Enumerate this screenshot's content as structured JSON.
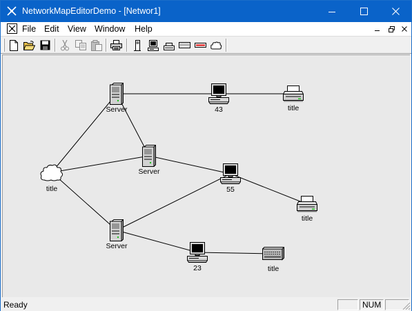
{
  "window": {
    "title": "NetworkMapEditorDemo - [Networ1]",
    "accent_color": "#0a63c9"
  },
  "menu": {
    "items": [
      "File",
      "Edit",
      "View",
      "Window",
      "Help"
    ]
  },
  "toolbar": {
    "buttons": [
      {
        "name": "new-file-icon",
        "enabled": true
      },
      {
        "name": "open-folder-icon",
        "enabled": true
      },
      {
        "name": "save-icon",
        "enabled": true
      },
      {
        "name": "cut-icon",
        "enabled": false
      },
      {
        "name": "copy-icon",
        "enabled": false
      },
      {
        "name": "paste-icon",
        "enabled": false
      },
      {
        "name": "print-icon",
        "enabled": true
      },
      {
        "name": "server-tool-icon",
        "enabled": true
      },
      {
        "name": "computer-tool-icon",
        "enabled": true
      },
      {
        "name": "printer-tool-icon",
        "enabled": true
      },
      {
        "name": "hub-tool-icon",
        "enabled": true
      },
      {
        "name": "link-tool-icon",
        "enabled": true
      },
      {
        "name": "cloud-tool-icon",
        "enabled": true
      }
    ]
  },
  "network": {
    "nodes": [
      {
        "id": "server1",
        "type": "server",
        "label": "Server"
      },
      {
        "id": "pc43",
        "type": "computer",
        "label": "43"
      },
      {
        "id": "printer1",
        "type": "printer",
        "label": "title"
      },
      {
        "id": "server2",
        "type": "server",
        "label": "Server"
      },
      {
        "id": "cloud1",
        "type": "cloud",
        "label": "title"
      },
      {
        "id": "pc55",
        "type": "computer",
        "label": "55"
      },
      {
        "id": "printer2",
        "type": "printer",
        "label": "title"
      },
      {
        "id": "server3",
        "type": "server",
        "label": "Server"
      },
      {
        "id": "pc23",
        "type": "computer",
        "label": "23"
      },
      {
        "id": "hub1",
        "type": "hub",
        "label": "title"
      }
    ],
    "links": [
      [
        "server1",
        "pc43"
      ],
      [
        "pc43",
        "printer1"
      ],
      [
        "server1",
        "cloud1"
      ],
      [
        "server1",
        "server2"
      ],
      [
        "cloud1",
        "server2"
      ],
      [
        "server2",
        "pc55"
      ],
      [
        "cloud1",
        "server3"
      ],
      [
        "server3",
        "pc55"
      ],
      [
        "pc55",
        "printer2"
      ],
      [
        "server3",
        "pc23"
      ],
      [
        "pc23",
        "hub1"
      ]
    ]
  },
  "statusbar": {
    "text": "Ready",
    "panes": [
      "",
      "NUM",
      ""
    ]
  }
}
